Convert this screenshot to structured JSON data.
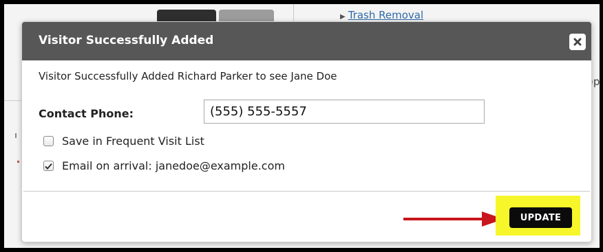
{
  "background": {
    "link_label": "Trash Removal",
    "right_edge_fragment": ")p"
  },
  "modal": {
    "title": "Visitor Successfully Added",
    "close_icon": "close-icon",
    "message": "Visitor Successfully Added Richard Parker to see Jane Doe",
    "contact_phone_label": "Contact Phone:",
    "contact_phone_value": "(555) 555-5557",
    "save_frequent_label": "Save in Frequent Visit List",
    "save_frequent_checked": false,
    "email_arrival_label": "Email on arrival: janedoe@example.com",
    "email_arrival_checked": true,
    "update_label": "UPDATE"
  },
  "colors": {
    "header_bg": "#575757",
    "highlight": "#f6f62a",
    "arrow": "#c8161d",
    "button_bg": "#0b0b0b"
  }
}
